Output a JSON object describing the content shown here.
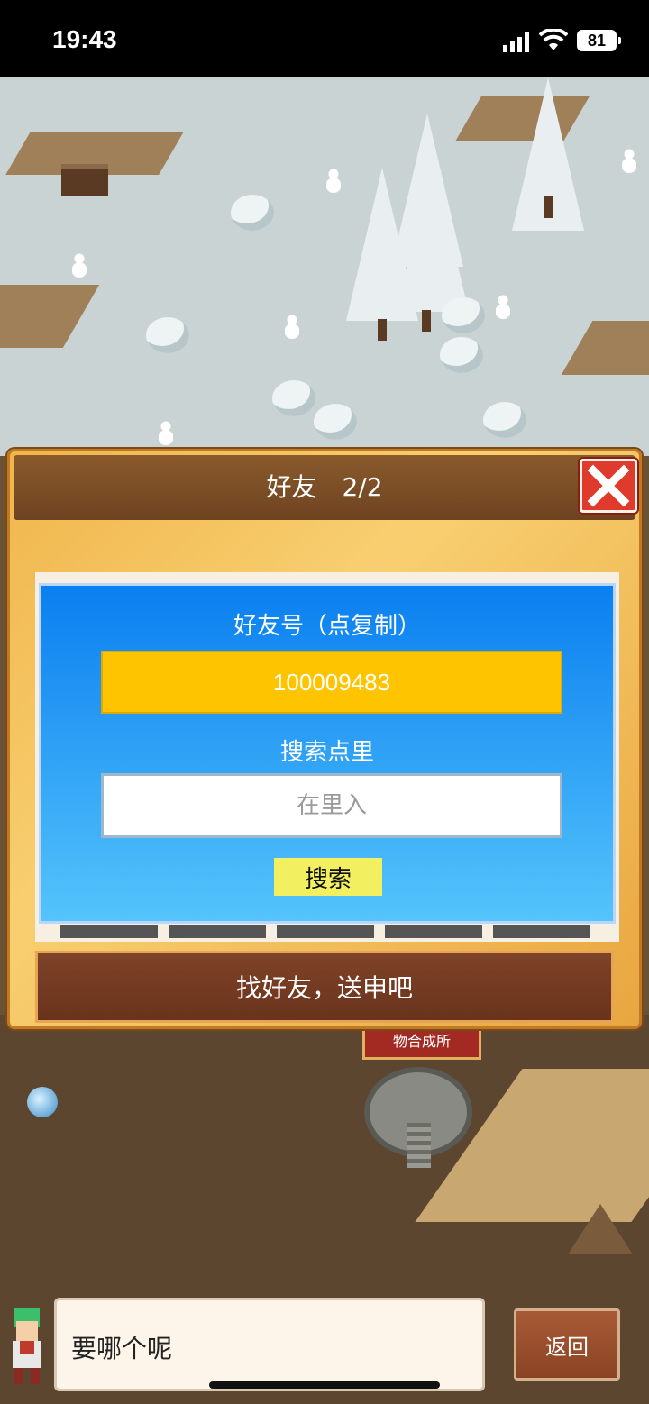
{
  "status_bar": {
    "time": "19:43",
    "battery": "81",
    "icons": [
      "signal-icon",
      "wifi-icon",
      "battery-icon"
    ]
  },
  "dialog": {
    "title": "好友　2/2",
    "close_icon": "close-icon",
    "friend_id_label": "好友号（点复制）",
    "friend_id": "100009483",
    "search_label": "搜索点里",
    "search_placeholder": "在里入",
    "search_button": "搜索",
    "send_button": "找好友，送申吧",
    "nav_icons": [
      "arrow-left-icon",
      "arrow-right-icon"
    ]
  },
  "scene": {
    "sign_text": "物合成所"
  },
  "footer": {
    "speech": "要哪个呢",
    "back_button": "返回"
  },
  "colors": {
    "panel_top": "#0a7ff0",
    "panel_bottom": "#55c4fb",
    "friend_id_bg": "#ffc400",
    "search_button_bg": "#f2f060",
    "close_bg": "#e03a2c",
    "header_bg": "#6e4320"
  }
}
